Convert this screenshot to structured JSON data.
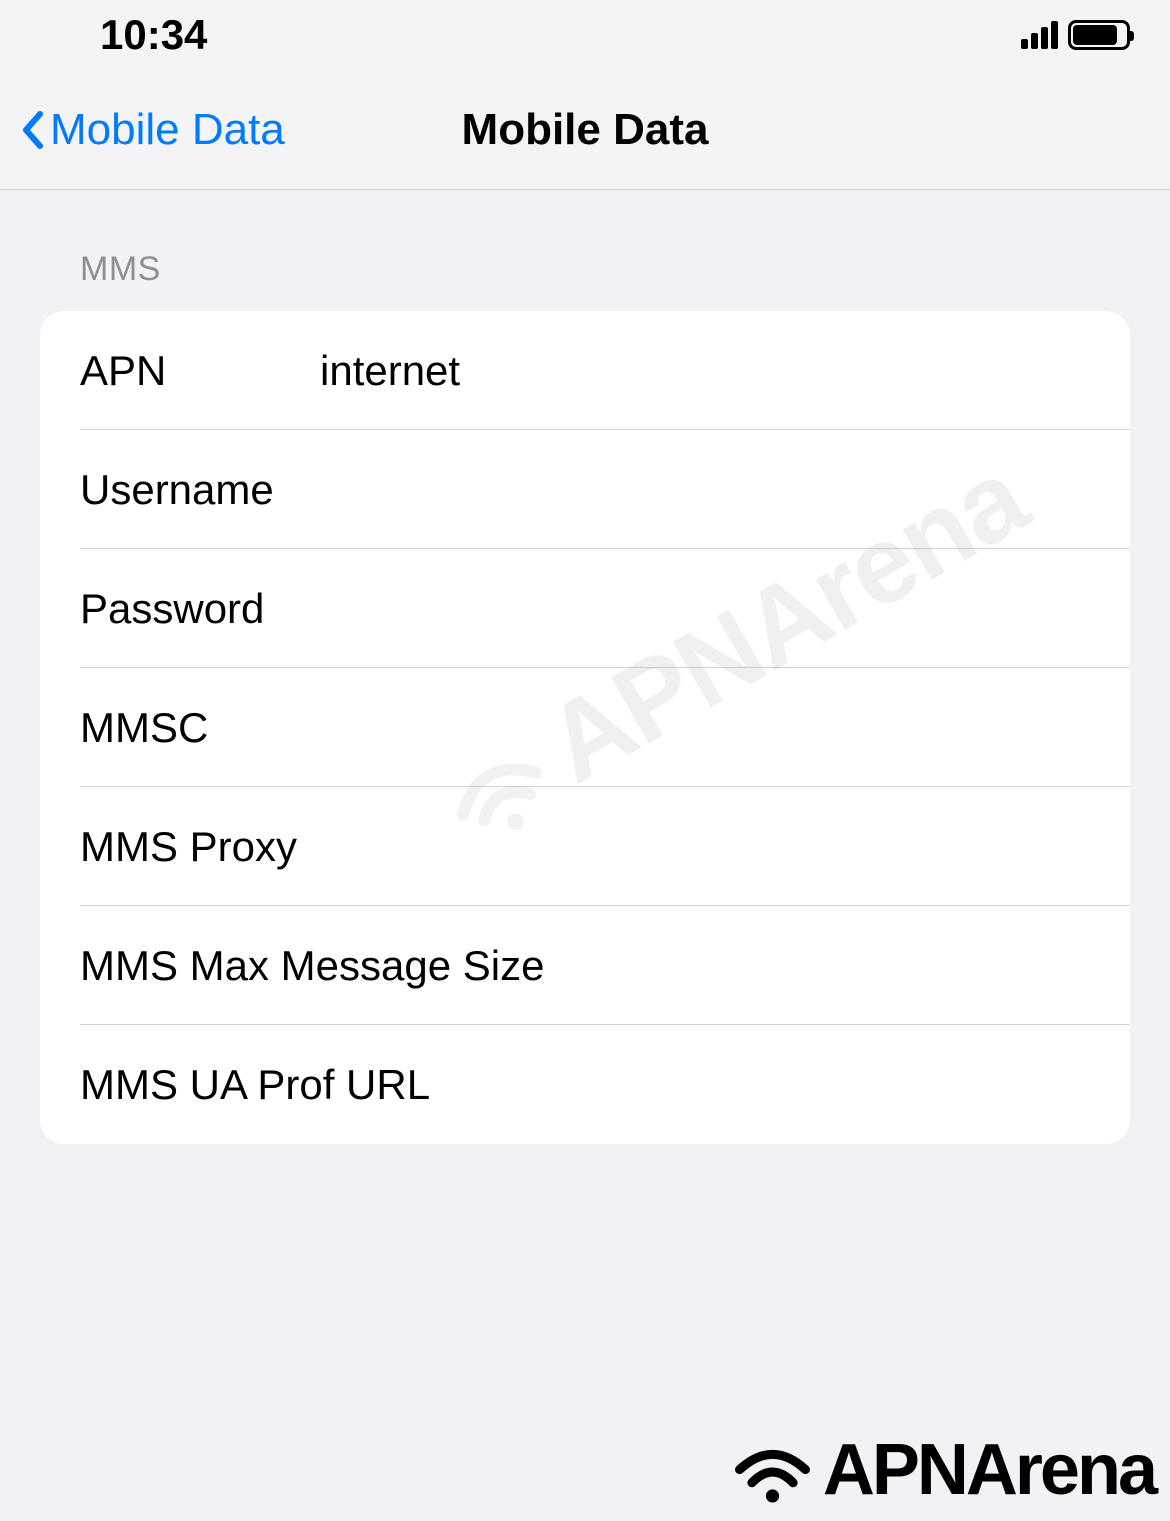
{
  "status_bar": {
    "time": "10:34"
  },
  "nav": {
    "back_label": "Mobile Data",
    "title": "Mobile Data"
  },
  "section": {
    "header": "MMS",
    "rows": [
      {
        "label": "APN",
        "value": "internet"
      },
      {
        "label": "Username",
        "value": ""
      },
      {
        "label": "Password",
        "value": ""
      },
      {
        "label": "MMSC",
        "value": ""
      },
      {
        "label": "MMS Proxy",
        "value": ""
      },
      {
        "label": "MMS Max Message Size",
        "value": ""
      },
      {
        "label": "MMS UA Prof URL",
        "value": ""
      }
    ]
  },
  "watermark": "APNArena",
  "brand": "APNArena"
}
